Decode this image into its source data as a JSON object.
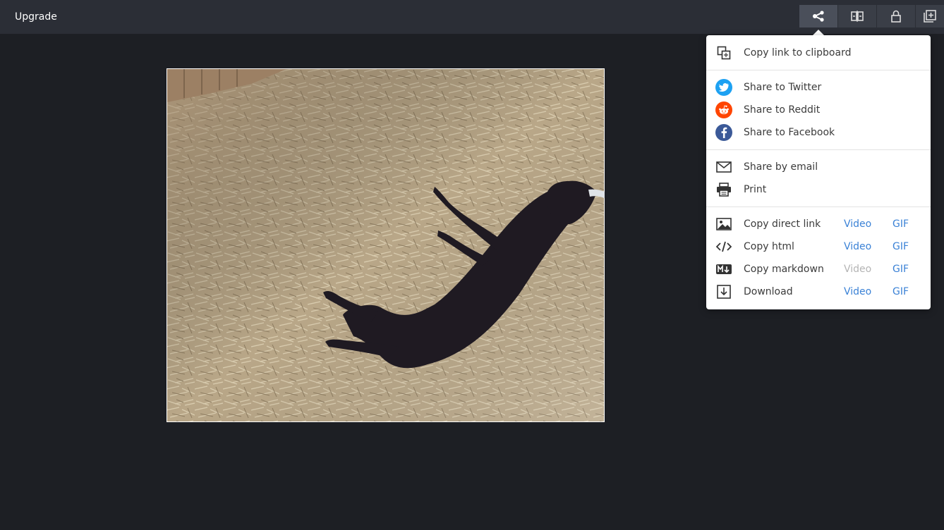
{
  "topbar": {
    "upgrade_label": "Upgrade",
    "buttons": [
      {
        "icon": "share-icon",
        "active": true
      },
      {
        "icon": "compare-icon"
      },
      {
        "icon": "lock-icon"
      },
      {
        "icon": "add-to-collection-icon"
      }
    ]
  },
  "share_menu": {
    "copy_link": "Copy link to clipboard",
    "twitter": "Share to Twitter",
    "reddit": "Share to Reddit",
    "facebook": "Share to Facebook",
    "email": "Share by email",
    "print": "Print",
    "direct_link": "Copy direct link",
    "html": "Copy html",
    "markdown": "Copy markdown",
    "download": "Download",
    "video_label": "Video",
    "gif_label": "GIF"
  },
  "colors": {
    "twitter": "#1da1f2",
    "reddit": "#ff4500",
    "facebook": "#3b5998",
    "link": "#3b82d6"
  }
}
